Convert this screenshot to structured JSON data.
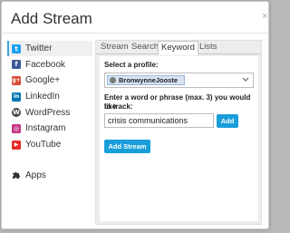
{
  "dialog": {
    "title": "Add Stream",
    "close_glyph": "×"
  },
  "sidebar": {
    "items": [
      {
        "label": "Twitter",
        "icon": "twitter-icon",
        "color": "#1da1f2",
        "glyph": "t",
        "active": true
      },
      {
        "label": "Facebook",
        "icon": "facebook-icon",
        "color": "#3b5998",
        "glyph": "f"
      },
      {
        "label": "Google+",
        "icon": "google-plus-icon",
        "color": "#dd4b39",
        "glyph": "g+"
      },
      {
        "label": "LinkedIn",
        "icon": "linkedin-icon",
        "color": "#0077b5",
        "glyph": "in"
      },
      {
        "label": "WordPress",
        "icon": "wordpress-icon",
        "color": "#464646",
        "glyph": "W"
      },
      {
        "label": "Instagram",
        "icon": "instagram-icon",
        "color": "#c13584",
        "glyph": "◎"
      },
      {
        "label": "YouTube",
        "icon": "youtube-icon",
        "color": "#e52d27",
        "glyph": "▶"
      }
    ],
    "apps": {
      "label": "Apps",
      "icon": "puzzle-icon"
    }
  },
  "tabs": [
    {
      "label": "Stream"
    },
    {
      "label": "Search"
    },
    {
      "label": "Keyword",
      "active": true
    },
    {
      "label": "Lists"
    }
  ],
  "form": {
    "profile_label": "Select a profile:",
    "profile_selected": "BronwynneJooste",
    "keyword_label_line1": "Enter a word or phrase (max. 3) you would like",
    "keyword_label_line2": "to track:",
    "keyword_value": "crisis communications",
    "add_label": "Add",
    "add_stream_label": "Add Stream"
  },
  "colors": {
    "accent": "#1a9ed9",
    "active_border": "#3fa3d8"
  }
}
